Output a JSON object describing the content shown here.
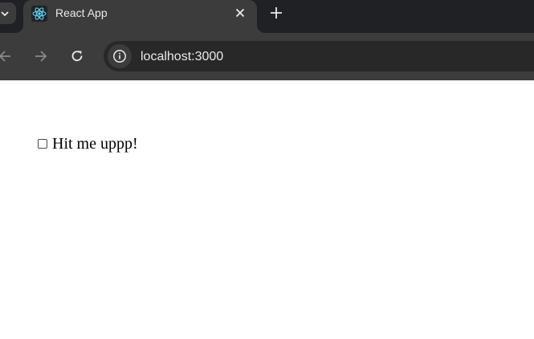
{
  "browser": {
    "tab": {
      "title": "React App",
      "favicon": "react-logo-icon"
    },
    "toolbar": {
      "url": "localhost:3000",
      "site_info_icon": "info-icon"
    },
    "icons": {
      "tab_list": "chevron-down-icon",
      "close": "close-icon",
      "new_tab": "plus-icon",
      "back": "arrow-left-icon",
      "forward": "arrow-right-icon",
      "reload": "reload-icon"
    }
  },
  "page": {
    "checkbox": {
      "label": "Hit me uppp!",
      "checked": false
    }
  },
  "colors": {
    "tabstrip_bg": "#202124",
    "active_tab_bg": "#3c3c3c",
    "omnibox_bg": "#282828",
    "react_blue": "#61dafb",
    "page_bg": "#ffffff"
  }
}
